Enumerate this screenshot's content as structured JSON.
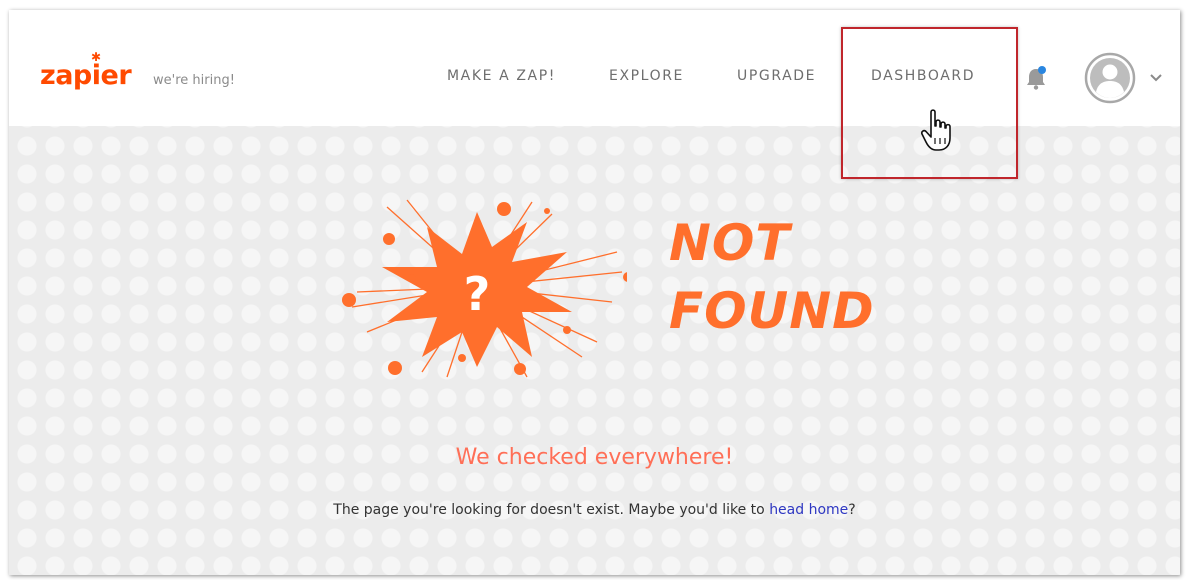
{
  "brand": {
    "logo_text": "zapier",
    "tagline": "we're hiring!",
    "accent_color": "#ff4a00"
  },
  "nav": {
    "items": [
      {
        "label": "MAKE A ZAP!"
      },
      {
        "label": "EXPLORE"
      },
      {
        "label": "UPGRADE"
      },
      {
        "label": "DASHBOARD"
      }
    ],
    "highlighted_item": "DASHBOARD"
  },
  "user_menu": {
    "notification_icon": "bell-icon",
    "avatar_icon": "user-avatar-icon",
    "dropdown_icon": "chevron-down-icon"
  },
  "error": {
    "title_line1": "NOT",
    "title_line2": "FOUND",
    "splat_symbol": "?",
    "headline": "We checked everywhere!",
    "message_prefix": "The page you're looking for doesn't exist. Maybe you'd like to ",
    "link_text": "head home",
    "message_suffix": "?"
  },
  "colors": {
    "error_orange": "#ff6f2c",
    "link_blue": "#2e37c2",
    "highlight_box": "#c0262c"
  }
}
